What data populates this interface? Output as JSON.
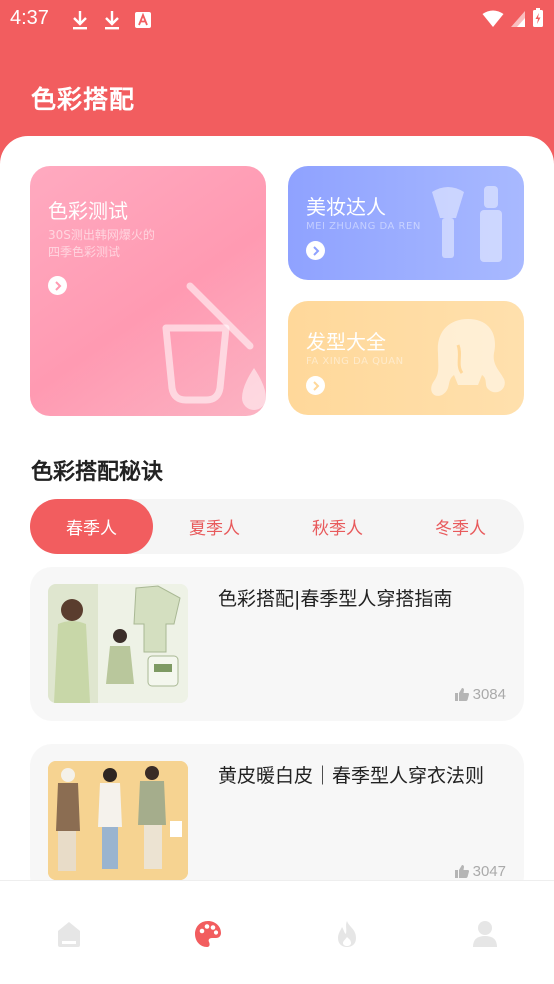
{
  "status_bar": {
    "time": "4:37",
    "icons_left": [
      "download-icon",
      "download-icon",
      "app-a-icon"
    ],
    "icons_right": [
      "wifi-icon",
      "signal-icon",
      "battery-charging-icon"
    ]
  },
  "header": {
    "title": "色彩搭配"
  },
  "features": {
    "color_test": {
      "title": "色彩测试",
      "subtitle_line1": "30S测出韩网爆火的",
      "subtitle_line2": "四季色彩测试"
    },
    "makeup": {
      "title": "美妆达人",
      "subtitle": "MEI ZHUANG DA REN"
    },
    "hair": {
      "title": "发型大全",
      "subtitle": "FA XING DA QUAN"
    }
  },
  "section": {
    "title": "色彩搭配秘诀"
  },
  "tabs": [
    {
      "label": "春季人",
      "active": true
    },
    {
      "label": "夏季人",
      "active": false
    },
    {
      "label": "秋季人",
      "active": false
    },
    {
      "label": "冬季人",
      "active": false
    }
  ],
  "articles": [
    {
      "title": "色彩搭配|春季型人穿搭指南",
      "likes": "3084"
    },
    {
      "title": "黄皮暖白皮｜春季型人穿衣法则",
      "likes": "3047"
    }
  ],
  "bottom_nav": [
    {
      "icon": "home-icon",
      "active": false
    },
    {
      "icon": "palette-icon",
      "active": true
    },
    {
      "icon": "fire-icon",
      "active": false
    },
    {
      "icon": "user-icon",
      "active": false
    }
  ],
  "colors": {
    "accent": "#f25d5f",
    "card_pink": "#ff9ab2",
    "card_blue": "#8fa2ff",
    "card_yellow": "#ffd89a",
    "nav_inactive": "#e6e6e6"
  }
}
